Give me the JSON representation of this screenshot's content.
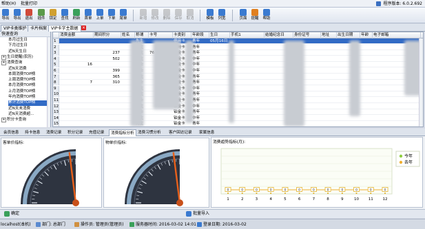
{
  "menu": {
    "items": [
      "帮助(H)",
      "批量打印"
    ],
    "version": "程序版本: 6.0.2.692"
  },
  "toolbar": {
    "buttons": [
      {
        "label": "导出",
        "icon": "export-icon",
        "color": "#3a7ad0",
        "disabled": false
      },
      {
        "label": "导出",
        "icon": "export-icon",
        "color": "#3a7ad0",
        "disabled": false
      },
      {
        "label": "退出",
        "icon": "exit-icon",
        "color": "#d04a3a",
        "disabled": false
      },
      {
        "label": "插件",
        "icon": "plugin-icon",
        "color": "#5a9a4a",
        "disabled": false
      },
      {
        "label": "锁定",
        "icon": "lock-icon",
        "color": "#d0a030",
        "disabled": false
      },
      {
        "label": "查找",
        "icon": "search-icon",
        "color": "#3a7ad0",
        "disabled": false
      },
      {
        "label": "刷新",
        "icon": "refresh-icon",
        "color": "#3aa05a",
        "disabled": false
      },
      {
        "label": "首单",
        "icon": "first-icon",
        "color": "#3a7ad0",
        "disabled": false
      },
      {
        "label": "上单",
        "icon": "prev-icon",
        "color": "#3a7ad0",
        "disabled": false
      },
      {
        "label": "下单",
        "icon": "next-icon",
        "color": "#3a7ad0",
        "disabled": false
      },
      {
        "label": "尾单",
        "icon": "last-icon",
        "color": "#3a7ad0",
        "disabled": false
      },
      {
        "label": "新增",
        "icon": "add-icon",
        "color": "#888",
        "disabled": true
      },
      {
        "label": "修改",
        "icon": "edit-icon",
        "color": "#888",
        "disabled": true
      },
      {
        "label": "删除",
        "icon": "delete-icon",
        "color": "#888",
        "disabled": true
      },
      {
        "label": "保存",
        "icon": "save-icon",
        "color": "#888",
        "disabled": true
      },
      {
        "label": "取消",
        "icon": "cancel-icon",
        "color": "#888",
        "disabled": true
      },
      {
        "label": "模板",
        "icon": "template-icon",
        "color": "#3a7ad0",
        "disabled": false
      },
      {
        "label": "列宽",
        "icon": "column-width-icon",
        "color": "#3a7ad0",
        "disabled": false
      },
      {
        "label": "页面",
        "icon": "page-icon",
        "color": "#3a7ad0",
        "disabled": false
      },
      {
        "label": "提醒",
        "icon": "alert-icon",
        "color": "#e08020",
        "disabled": false
      },
      {
        "label": "帮助",
        "icon": "help-icon",
        "color": "#3a7ad0",
        "disabled": false
      }
    ]
  },
  "doc_tabs": [
    "VIP卡类维护",
    "卡片档案",
    "VIP卡字主数据"
  ],
  "left_tree": {
    "title": "快速查询",
    "items": [
      {
        "label": "本月过生日",
        "indent": 2,
        "sel": false,
        "branch": false
      },
      {
        "label": "下月过生日",
        "indent": 2,
        "sel": false,
        "branch": false
      },
      {
        "label": "近N天生日",
        "indent": 2,
        "sel": false,
        "branch": false
      },
      {
        "label": "生日提醒(农历)",
        "indent": 0,
        "sel": false,
        "branch": true
      },
      {
        "label": "消费查询",
        "indent": 0,
        "sel": false,
        "branch": true
      },
      {
        "label": "近N天消费",
        "indent": 2,
        "sel": false,
        "branch": false
      },
      {
        "label": "本周消费TOP榜",
        "indent": 2,
        "sel": false,
        "branch": false
      },
      {
        "label": "上周消费TOP榜",
        "indent": 2,
        "sel": false,
        "branch": false
      },
      {
        "label": "本月消费TOP榜",
        "indent": 2,
        "sel": false,
        "branch": false
      },
      {
        "label": "上月消费TOP榜",
        "indent": 2,
        "sel": false,
        "branch": false
      },
      {
        "label": "年内消费TOP榜",
        "indent": 2,
        "sel": false,
        "branch": false
      },
      {
        "label": "累计消费TOP榜",
        "indent": 2,
        "sel": true,
        "branch": false
      },
      {
        "label": "近N天未消费",
        "indent": 2,
        "sel": false,
        "branch": false
      },
      {
        "label": "近N天消费超...",
        "indent": 2,
        "sel": false,
        "branch": false
      },
      {
        "label": "积分卡查询",
        "indent": 0,
        "sel": false,
        "branch": true
      }
    ]
  },
  "grid": {
    "headers": [
      "",
      "消费金额",
      "期间积分",
      "姓名",
      "称谓",
      "卡号",
      "卡类别",
      "年龄段",
      "生日",
      "手机1",
      "结婚纪念日",
      "身份证号",
      "地址",
      "出生日期",
      "年龄",
      "电子邮箱"
    ],
    "rows": [
      {
        "n": "1",
        "amount": "",
        "points": "",
        "name": "",
        "title": "先生",
        "card": "",
        "type": "停用卡",
        "age": "青年",
        "bday": "05月16日",
        "sel": true
      },
      {
        "n": "2",
        "amount": "",
        "points": "",
        "name": "",
        "title": "先生",
        "card": "",
        "type": "停用卡",
        "age": "青年",
        "bday": "",
        "sel": false
      },
      {
        "n": "3",
        "amount": "",
        "points": "237",
        "name": "",
        "title": "先生",
        "card": "76",
        "type": "铂金卡",
        "age": "青年",
        "bday": "",
        "sel": false
      },
      {
        "n": "4",
        "amount": "",
        "points": "502",
        "name": "",
        "title": "先生",
        "card": "",
        "type": "铂金卡",
        "age": "中年",
        "bday": "",
        "sel": false
      },
      {
        "n": "5",
        "amount": "16",
        "points": "",
        "name": "",
        "title": "女士",
        "card": "",
        "type": "铂金卡",
        "age": "中年",
        "bday": "",
        "sel": false
      },
      {
        "n": "6",
        "amount": "",
        "points": "399",
        "name": "",
        "title": "女士",
        "card": "",
        "type": "铂金卡",
        "age": "中年",
        "bday": "",
        "sel": false
      },
      {
        "n": "7",
        "amount": "",
        "points": "365",
        "name": "",
        "title": "先生",
        "card": "",
        "type": "铂金卡",
        "age": "青年",
        "bday": "",
        "sel": false
      },
      {
        "n": "8",
        "amount": "7",
        "points": "310",
        "name": "",
        "title": "女士",
        "card": "",
        "type": "铂金卡",
        "age": "青年",
        "bday": "",
        "sel": false
      },
      {
        "n": "9",
        "amount": "",
        "points": "",
        "name": "",
        "title": "先生",
        "card": "",
        "type": "铂金卡",
        "age": "中年",
        "bday": "",
        "sel": false
      },
      {
        "n": "10",
        "amount": "",
        "points": "",
        "name": "",
        "title": "先生",
        "card": "",
        "type": "铂金卡",
        "age": "青年",
        "bday": "",
        "sel": false
      },
      {
        "n": "11",
        "amount": "",
        "points": "",
        "name": "",
        "title": "女士",
        "card": "",
        "type": "铂金卡",
        "age": "青年",
        "bday": "",
        "sel": false
      },
      {
        "n": "12",
        "amount": "",
        "points": "",
        "name": "",
        "title": "先生",
        "card": "",
        "type": "铂金卡",
        "age": "中年",
        "bday": "",
        "sel": false
      },
      {
        "n": "13",
        "amount": "",
        "points": "",
        "name": "",
        "title": "女士",
        "card": "",
        "type": "铂金卡",
        "age": "青年",
        "bday": "",
        "sel": false
      },
      {
        "n": "14",
        "amount": "",
        "points": "",
        "name": "",
        "title": "先生",
        "card": "",
        "type": "铂金卡",
        "age": "中年",
        "bday": "",
        "sel": false
      },
      {
        "n": "15",
        "amount": "",
        "points": "",
        "name": "",
        "title": "先生",
        "card": "",
        "type": "铂金卡",
        "age": "青年",
        "bday": "",
        "sel": false
      }
    ]
  },
  "bottom_tabs": [
    {
      "label": "会员信息",
      "active": false
    },
    {
      "label": "持卡信息",
      "active": false
    },
    {
      "label": "消费记录",
      "active": false
    },
    {
      "label": "积分记录",
      "active": false
    },
    {
      "label": "充值记录",
      "active": false
    },
    {
      "label": "消费指标分析",
      "active": true
    },
    {
      "label": "消费习惯分析",
      "active": false
    },
    {
      "label": "客户回访记录",
      "active": false
    },
    {
      "label": "家属信息",
      "active": false
    }
  ],
  "gauges": [
    {
      "title": "客单价指标:",
      "value_fraction": 0.08
    },
    {
      "title": "物单价指标:",
      "value_fraction": 0.08
    }
  ],
  "chart_data": {
    "type": "line",
    "title": "消费趋势指标(月):",
    "categories": [
      "1",
      "2",
      "3",
      "4",
      "5",
      "6",
      "7",
      "8",
      "9",
      "10",
      "11",
      "12"
    ],
    "series": [
      {
        "name": "今年",
        "values": [
          0,
          0,
          0,
          0,
          0,
          0,
          0,
          0,
          0,
          0,
          0,
          0
        ],
        "color": "#8fcf3f"
      },
      {
        "name": "去年",
        "values": [
          0,
          0,
          0,
          0,
          0,
          0,
          0,
          0,
          0,
          0,
          0,
          0
        ],
        "color": "#f0b030"
      }
    ],
    "legend": "top-right",
    "grid": true
  },
  "bottombar": {
    "confirm": "确定",
    "import": "批量导入"
  },
  "status": {
    "host": "localhost(本机)",
    "dept": "部门: 总部门",
    "operator": "操作员: 管理员(管理员)",
    "server_time": "服务器时间: 2016-03-02 14:01",
    "login_date": "登录日期: 2016-03-02"
  }
}
